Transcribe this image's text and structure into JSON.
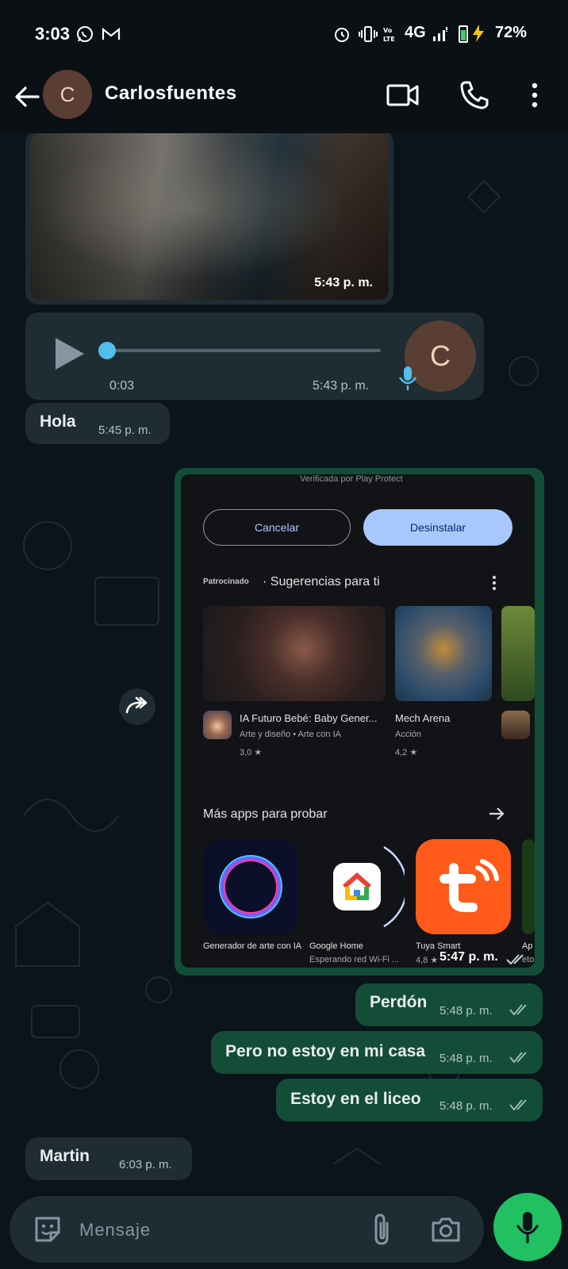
{
  "status_bar": {
    "time": "3:03",
    "network": "4G",
    "battery": "72%",
    "icons": [
      "whatsapp-icon",
      "gmail-icon",
      "alarm-icon",
      "vibrate-icon",
      "volte-icon",
      "signal-icon",
      "battery-icon"
    ]
  },
  "header": {
    "avatar_initial": "C",
    "contact_name": "Carlosfuentes"
  },
  "messages": {
    "image_time": "5:43 p. m.",
    "voice": {
      "duration": "0:03",
      "time": "5:43 p. m.",
      "avatar_initial": "C",
      "progress": 0
    },
    "hola": {
      "text": "Hola",
      "time": "5:45 p. m."
    },
    "screenshot": {
      "time": "5:47 p. m.",
      "top_text": "Verificada por Play Protect",
      "cancel_label": "Cancelar",
      "uninstall_label": "Desinstalar",
      "sponsored": "Patrocinado",
      "suggestions_title": "· Sugerencias para ti",
      "apps": [
        {
          "name": "IA Futuro Bebé: Baby Gener...",
          "category": "Arte y diseño • Arte con IA",
          "rating": "3,0 ★"
        },
        {
          "name": "Mech Arena",
          "category": "Acción",
          "rating": "4,2 ★"
        }
      ],
      "more_title": "Más apps para probar",
      "more_apps": [
        {
          "name": "Generador de arte con IA",
          "sub": ""
        },
        {
          "name": "Google Home",
          "sub": "Esperando red Wi-Fi ..."
        },
        {
          "name": "Tuya Smart",
          "sub": "4,8 ★"
        },
        {
          "name": "Ap",
          "sub": "eto"
        }
      ]
    },
    "perdon": {
      "text": "Perdón",
      "time": "5:48 p. m."
    },
    "pero": {
      "text": "Pero no estoy en mi casa",
      "time": "5:48 p. m."
    },
    "liceo": {
      "text": "Estoy en el liceo",
      "time": "5:48 p. m."
    },
    "martin": {
      "text": "Martin",
      "time": "6:03 p. m."
    }
  },
  "input": {
    "placeholder": "Mensaje"
  },
  "colors": {
    "outgoing_bubble": "#144d37",
    "incoming_bubble": "#1f2c33",
    "accent_green": "#21c063",
    "read_ticks": "#9fb7bd"
  }
}
